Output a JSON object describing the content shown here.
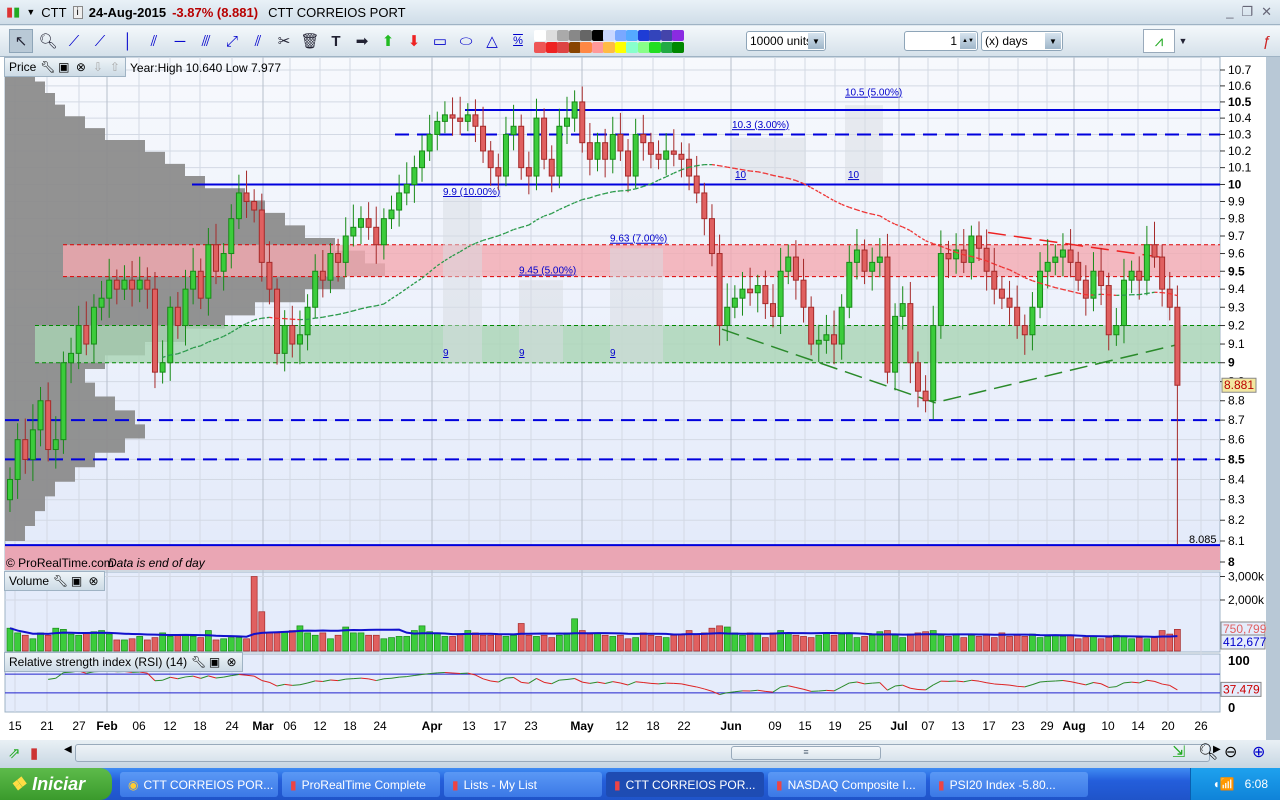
{
  "window": {
    "symbol": "CTT",
    "date": "24-Aug-2015",
    "change": "-3.87% (8.881)",
    "name": "CTT CORREIOS PORT",
    "controls": [
      "_",
      "❐",
      "✕"
    ]
  },
  "toolbar": {
    "units": "10000 units",
    "period_value": "1",
    "period_unit": "(x) days",
    "percent_tool": "%"
  },
  "colors": {
    "up": "#3ccc3c",
    "down": "#e06060",
    "up_edge": "#178a17",
    "down_edge": "#a52a2a",
    "level_blue": "#0000dd",
    "resistance_zone": "#f4a9b0",
    "support_zone": "#a9d4b4",
    "accent_change": "#b80000"
  },
  "palette": [
    "#ffffff",
    "#dddddd",
    "#aaaaaa",
    "#888888",
    "#666666",
    "#000000",
    "#c9d7ff",
    "#7aa8ff",
    "#55aaff",
    "#1e3cd6",
    "#3344bb",
    "#4444aa",
    "#8a2be2",
    "#ff88bb",
    "#ee5555",
    "#ee2222",
    "#dd4444",
    "#884400",
    "#ff8844",
    "#ff9999",
    "#ffbb44",
    "#ffff00",
    "#88ffcc",
    "#88ff88",
    "#22dd22",
    "#22aa44",
    "#008800"
  ],
  "price_panel": {
    "title": "Price",
    "info": "Year:High 10.640 Low 7.977",
    "copyright": "© ProRealTime.com",
    "note": "Data is end of day",
    "last_price": "8.881",
    "low_label": "8.085",
    "ticks": [
      "10.7",
      "10.6",
      "10.5",
      "10.4",
      "10.3",
      "10.2",
      "10.1",
      "10",
      "9.9",
      "9.8",
      "9.7",
      "9.6",
      "9.5",
      "9.4",
      "9.3",
      "9.2",
      "9.1",
      "9",
      "8.9",
      "8.8",
      "8.7",
      "8.6",
      "8.5",
      "8.4",
      "8.3",
      "8.2",
      "8.1",
      "8"
    ],
    "level_labels": [
      "10.5 (5.00%)",
      "10.3 (3.00%)",
      "10",
      "10",
      "9.9 (10.00%)",
      "9.63 (7.00%)",
      "9.45 (5.00%)",
      "9",
      "9",
      "9"
    ]
  },
  "volume_panel": {
    "title": "Volume",
    "ticks": [
      "3,000k",
      "2,000k"
    ],
    "last_volume": "750,799",
    "average": "412,677"
  },
  "rsi_panel": {
    "title": "Relative strength index (RSI) (14)",
    "ticks": [
      "100",
      "0"
    ],
    "last": "37.479"
  },
  "time_axis": [
    "15",
    "21",
    "27",
    "Feb",
    "06",
    "12",
    "18",
    "24",
    "Mar",
    "06",
    "12",
    "18",
    "24",
    "Apr",
    "13",
    "17",
    "23",
    "May",
    "12",
    "18",
    "22",
    "Jun",
    "09",
    "15",
    "19",
    "25",
    "Jul",
    "07",
    "13",
    "17",
    "23",
    "29",
    "Aug",
    "10",
    "14",
    "20",
    "26"
  ],
  "chart_data": {
    "type": "candlestick",
    "title": "CTT CORREIOS PORT",
    "yscale": "log",
    "ylim": [
      8,
      10.7
    ],
    "last": 8.881,
    "year_high": 10.64,
    "year_low": 7.977,
    "closes": [
      8.4,
      8.6,
      8.5,
      8.65,
      8.8,
      8.55,
      8.6,
      9.0,
      9.05,
      9.2,
      9.1,
      9.3,
      9.35,
      9.45,
      9.4,
      9.45,
      9.4,
      9.45,
      9.4,
      8.95,
      9.0,
      9.3,
      9.2,
      9.4,
      9.5,
      9.35,
      9.65,
      9.5,
      9.6,
      9.8,
      9.95,
      9.9,
      9.85,
      9.55,
      9.4,
      9.05,
      9.2,
      9.1,
      9.15,
      9.3,
      9.5,
      9.45,
      9.6,
      9.55,
      9.7,
      9.75,
      9.8,
      9.75,
      9.65,
      9.8,
      9.85,
      9.95,
      10.0,
      10.1,
      10.2,
      10.3,
      10.38,
      10.42,
      10.4,
      10.38,
      10.42,
      10.35,
      10.2,
      10.1,
      10.05,
      10.3,
      10.35,
      10.1,
      10.05,
      10.4,
      10.15,
      10.05,
      10.35,
      10.4,
      10.5,
      10.25,
      10.15,
      10.25,
      10.15,
      10.3,
      10.2,
      10.05,
      10.3,
      10.25,
      10.18,
      10.15,
      10.2,
      10.18,
      10.15,
      10.05,
      9.95,
      9.8,
      9.6,
      9.2,
      9.3,
      9.35,
      9.4,
      9.38,
      9.42,
      9.32,
      9.25,
      9.5,
      9.58,
      9.45,
      9.3,
      9.1,
      9.12,
      9.15,
      9.1,
      9.3,
      9.55,
      9.62,
      9.5,
      9.55,
      9.58,
      8.95,
      9.25,
      9.32,
      9.0,
      8.85,
      8.8,
      9.2,
      9.6,
      9.57,
      9.62,
      9.55,
      9.7,
      9.63,
      9.5,
      9.4,
      9.35,
      9.3,
      9.2,
      9.15,
      9.3,
      9.5,
      9.55,
      9.58,
      9.62,
      9.55,
      9.45,
      9.35,
      9.5,
      9.42,
      9.15,
      9.2,
      9.45,
      9.5,
      9.45,
      9.65,
      9.58,
      9.4,
      9.3,
      8.881
    ],
    "first_open": 8.3,
    "last_low": 8.085,
    "volumes_k": [
      800,
      600,
      500,
      350,
      600,
      500,
      800,
      750,
      550,
      500,
      600,
      650,
      700,
      550,
      300,
      300,
      350,
      450,
      300,
      400,
      600,
      450,
      500,
      500,
      450,
      400,
      700,
      300,
      350,
      400,
      400,
      350,
      3000,
      1500,
      600,
      600,
      650,
      700,
      900,
      600,
      500,
      600,
      350,
      500,
      850,
      600,
      600,
      500,
      500,
      350,
      400,
      450,
      450,
      700,
      900,
      650,
      600,
      450,
      450,
      550,
      700,
      600,
      500,
      500,
      550,
      450,
      500,
      1000,
      500,
      450,
      500,
      400,
      500,
      600,
      1200,
      700,
      550,
      600,
      500,
      450,
      500,
      350,
      400,
      600,
      500,
      450,
      400,
      500,
      550,
      700,
      550,
      600,
      800,
      900,
      850,
      600,
      500,
      600,
      550,
      400,
      600,
      700,
      600,
      500,
      450,
      400,
      500,
      600,
      500,
      550,
      600,
      400,
      450,
      500,
      650,
      700,
      500,
      400,
      550,
      600,
      650,
      700,
      500,
      450,
      550,
      400,
      500,
      450,
      500,
      400,
      600,
      450,
      500,
      450,
      550,
      400,
      450,
      500,
      450,
      500,
      350,
      400,
      450,
      350,
      400,
      500,
      450,
      350,
      400,
      350,
      400,
      700,
      550,
      751
    ],
    "levels": [
      {
        "price": 10.45,
        "style": "solid"
      },
      {
        "price": 10.3,
        "style": "dashed"
      },
      {
        "price": 10.0,
        "style": "solid"
      },
      {
        "price": 8.7,
        "style": "dashed"
      },
      {
        "price": 8.5,
        "style": "dashed"
      },
      {
        "price": 8.08,
        "style": "solid"
      }
    ],
    "resistance_zone": [
      9.47,
      9.65
    ],
    "support_zone": [
      9.0,
      9.2
    ],
    "volume_profile": [
      2,
      3,
      4,
      5,
      7,
      9,
      12,
      14,
      13,
      11,
      9,
      8,
      10,
      14,
      18,
      22,
      25,
      30,
      34,
      38,
      36,
      33,
      30,
      28,
      26,
      24,
      20,
      18,
      16,
      14,
      10,
      8,
      6,
      5,
      4,
      3
    ],
    "rsi_levels": [
      70,
      30
    ]
  }
}
